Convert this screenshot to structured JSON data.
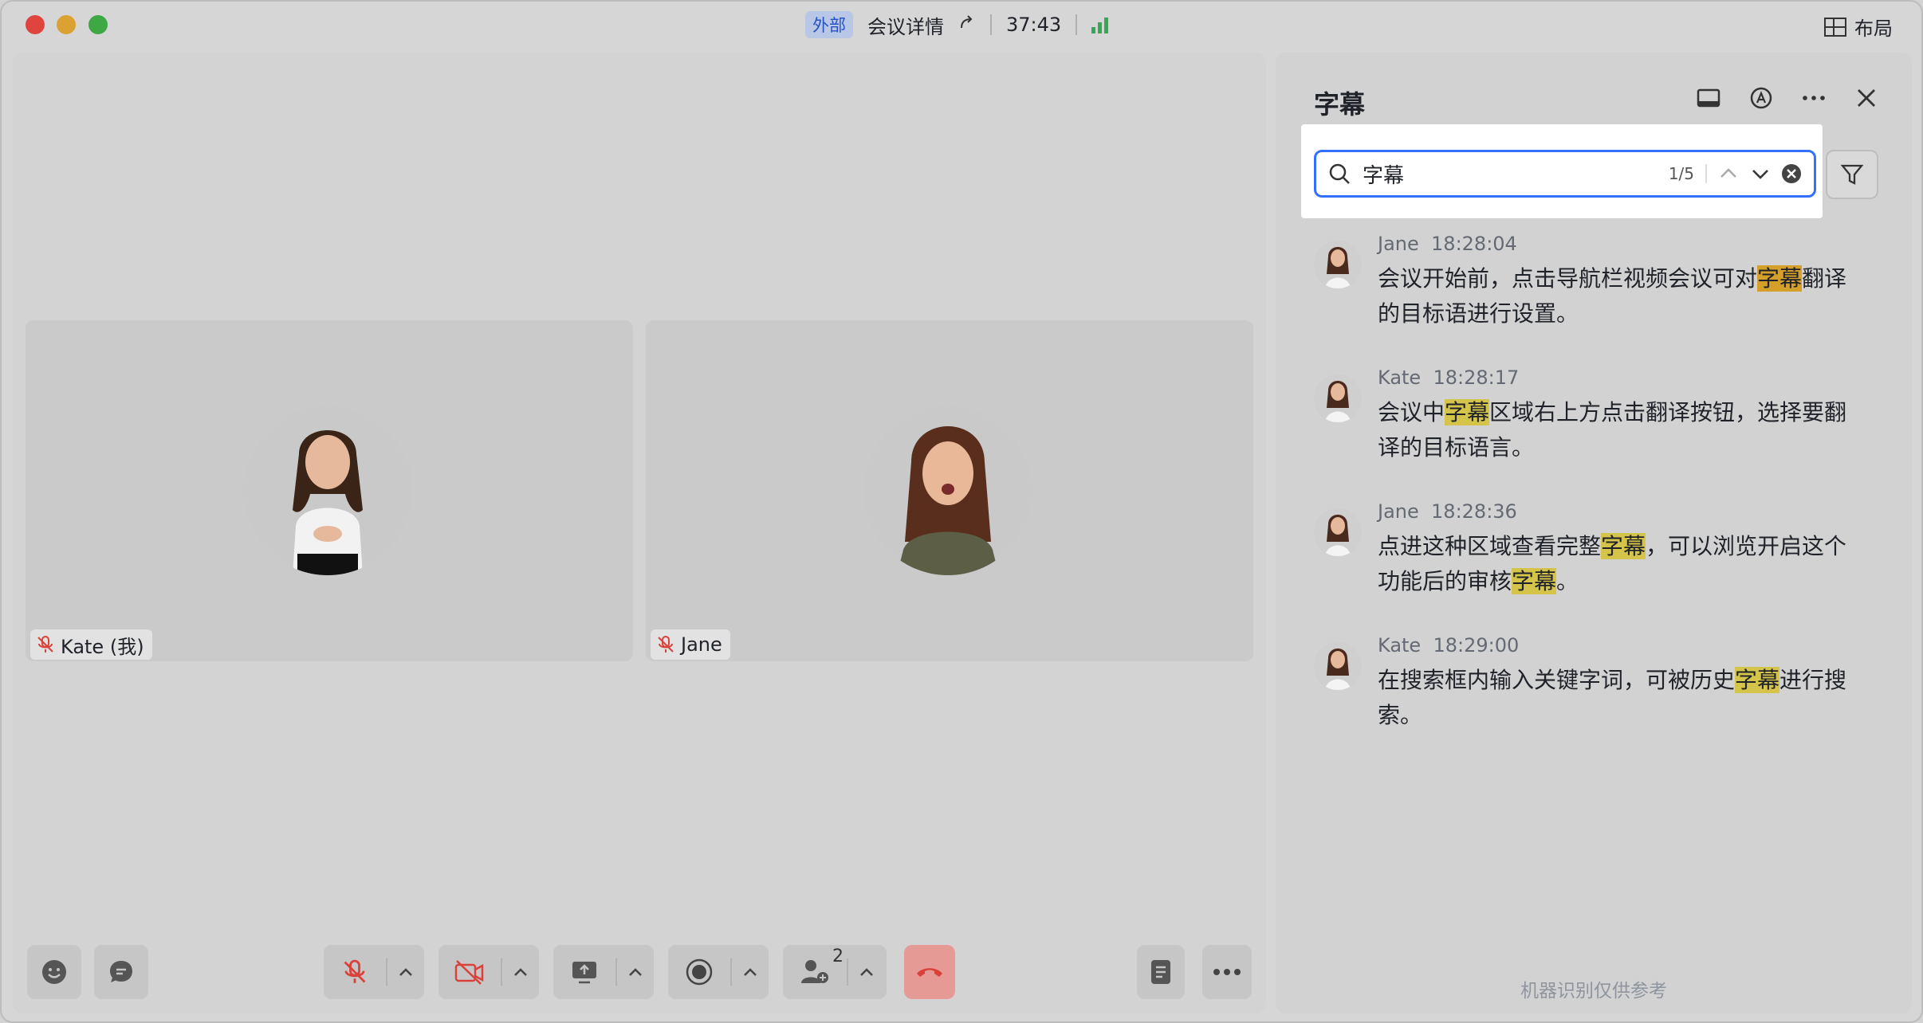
{
  "titlebar": {
    "badge": "外部",
    "meeting_details": "会议详情",
    "timer": "37:43",
    "layout_label": "布局"
  },
  "participants": [
    {
      "name": "Kate (我)",
      "muted": true
    },
    {
      "name": "Jane",
      "muted": true
    }
  ],
  "toolbar": {
    "participants_count": "2"
  },
  "panel": {
    "title": "字幕",
    "search": {
      "value": "字幕",
      "count": "1/5"
    },
    "entries": [
      {
        "speaker": "Jane",
        "time": "18:28:04",
        "parts": [
          "会议开始前，点击导航栏视频会议可对",
          "字幕",
          "翻译的目标语进行设置。"
        ]
      },
      {
        "speaker": "Kate",
        "time": "18:28:17",
        "parts": [
          "会议中",
          "字幕",
          "区域右上方点击翻译按钮，选择要翻译的目标语言。"
        ]
      },
      {
        "speaker": "Jane",
        "time": "18:28:36",
        "parts": [
          "点进这种区域查看完整",
          "字幕",
          "，可以浏览开启这个功能后的审核",
          "字幕",
          "。"
        ]
      },
      {
        "speaker": "Kate",
        "time": "18:29:00",
        "parts": [
          "在搜索框内输入关键字词，可被历史",
          "字幕",
          "进行搜索。"
        ]
      }
    ],
    "footnote": "机器识别仅供参考"
  },
  "colors": {
    "accent": "#3370ff",
    "highlight": "#d4c44a",
    "highlight_current": "#d4a02a",
    "hangup": "#e59a96",
    "mic_off": "#d9413a"
  }
}
